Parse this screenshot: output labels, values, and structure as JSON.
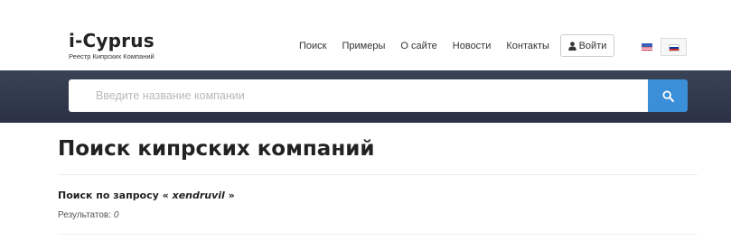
{
  "logo": {
    "title": "i-Cyprus",
    "subtitle": "Реестр Кипрских Компаний"
  },
  "nav": {
    "items": [
      "Поиск",
      "Примеры",
      "О сайте",
      "Новости",
      "Контакты"
    ]
  },
  "login": {
    "label": "Войти",
    "icon": "user-icon"
  },
  "languages": {
    "items": [
      "en-flag-icon",
      "ru-flag-icon"
    ],
    "active": "ru-flag-icon"
  },
  "search": {
    "placeholder": "Введите название компании",
    "value": "",
    "button_icon": "search-icon",
    "button_color": "#3a8fd8"
  },
  "main": {
    "title": "Поиск кипрских компаний",
    "query_prefix": "Поиск по запросу «",
    "query_term": "xendruvil",
    "query_suffix": "»",
    "results_label": "Результатов:",
    "results_count": "0"
  },
  "colors": {
    "search_band": "#2f3649",
    "accent": "#3a8fd8"
  }
}
